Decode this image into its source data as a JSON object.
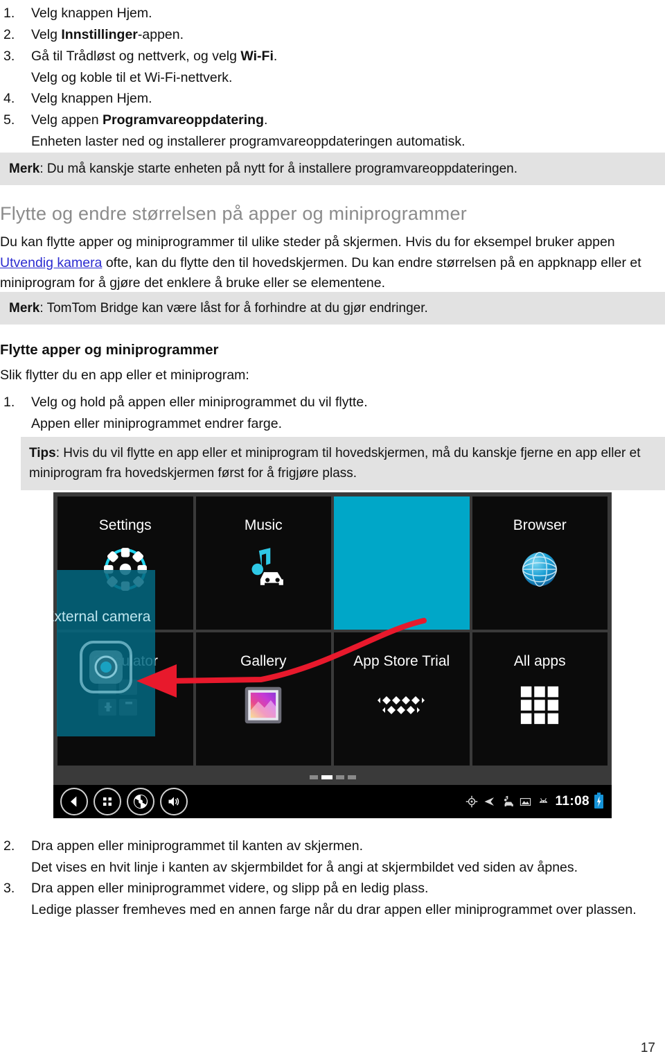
{
  "steps_top": [
    {
      "num": "1.",
      "text_before": "Velg knappen Hjem.",
      "bold": "",
      "text_after": ""
    },
    {
      "num": "2.",
      "text_before": "Velg ",
      "bold": "Innstillinger",
      "text_after": "-appen."
    },
    {
      "num": "3.",
      "text_before": "Gå til Trådløst og nettverk, og velg ",
      "bold": "Wi-Fi",
      "text_after": "."
    },
    {
      "num": "4.",
      "text_before": "Velg knappen Hjem.",
      "bold": "",
      "text_after": ""
    },
    {
      "num": "5.",
      "text_before": "Velg appen ",
      "bold": "Programvareoppdatering",
      "text_after": "."
    }
  ],
  "step3_sub": "Velg og koble til et Wi-Fi-nettverk.",
  "step5_sub": "Enheten laster ned og installerer programvareoppdateringen automatisk.",
  "note1": {
    "label": "Merk",
    "text": ": Du må kanskje starte enheten på nytt for å installere programvareoppdateringen."
  },
  "heading_main": "Flytte og endre størrelsen på apper og miniprogrammer",
  "paragraph_main": {
    "part1": "Du kan flytte apper og miniprogrammer til ulike steder på skjermen. Hvis du for eksempel bruker appen ",
    "link": "Utvendig kamera",
    "part2": " ofte, kan du flytte den til hovedskjermen. Du kan endre størrelsen på en appknapp eller et miniprogram for å gjøre det enklere å bruke eller se elementene."
  },
  "note2": {
    "label": "Merk",
    "text": ": TomTom Bridge kan være låst for å forhindre at du gjør endringer."
  },
  "heading_sub": "Flytte apper og miniprogrammer",
  "intro_sub": "Slik flytter du en app eller et miniprogram:",
  "step_move_1": {
    "num": "1.",
    "text": "Velg og hold på appen eller miniprogrammet du vil flytte."
  },
  "step_move_1_sub": "Appen eller miniprogrammet endrer farge.",
  "tips": {
    "label": "Tips",
    "text": ": Hvis du vil flytte en app eller et miniprogram til hovedskjermen, må du kanskje fjerne en app eller et miniprogram fra hovedskjermen først for å frigjøre plass."
  },
  "device": {
    "row1": [
      {
        "label": "Settings",
        "icon": "gear-icon",
        "highlight": false
      },
      {
        "label": "Music",
        "icon": "music-car-icon",
        "highlight": false
      },
      {
        "label": "",
        "icon": "",
        "highlight": true
      },
      {
        "label": "Browser",
        "icon": "globe-icon",
        "highlight": false
      }
    ],
    "row2": [
      {
        "label": "Calculator",
        "icon": "calculator-icon",
        "highlight": false
      },
      {
        "label": "Gallery",
        "icon": "gallery-icon",
        "highlight": false
      },
      {
        "label": "App Store Trial",
        "icon": "appstore-icon",
        "highlight": false
      },
      {
        "label": "All apps",
        "icon": "all-apps-grid-icon",
        "highlight": false
      }
    ],
    "dragged_tile_label": "External camera",
    "navbar": {
      "buttons": [
        "back-icon",
        "recents-icon",
        "camera-shutter-icon",
        "volume-icon"
      ],
      "status_icons": [
        "gps-icon",
        "navigation-arrow-icon",
        "car-music-icon",
        "image-icon",
        "android-icon"
      ],
      "clock": "11:08",
      "battery": "battery-charging-icon"
    },
    "page_dots": {
      "count": 4,
      "active_index": 1
    }
  },
  "steps_bottom": [
    {
      "num": "2.",
      "text": "Dra appen eller miniprogrammet til kanten av skjermen."
    },
    {
      "sub": "Det vises en hvit linje i kanten av skjermbildet for å angi at skjermbildet ved siden av åpnes."
    },
    {
      "num": "3.",
      "text": "Dra appen eller miniprogrammet videre, og slipp på en ledig plass."
    },
    {
      "sub": "Ledige plasser fremheves med en annen farge når du drar appen eller miniprogrammet over plassen."
    }
  ],
  "page_number": "17",
  "colors": {
    "note_bg": "#e2e2e2",
    "heading_gray": "#8b8b8b",
    "link_blue": "#2b2bd0",
    "tile_highlight": "#00a7c8",
    "arrow_red": "#e8192c",
    "dragged_tile": "#036880"
  }
}
